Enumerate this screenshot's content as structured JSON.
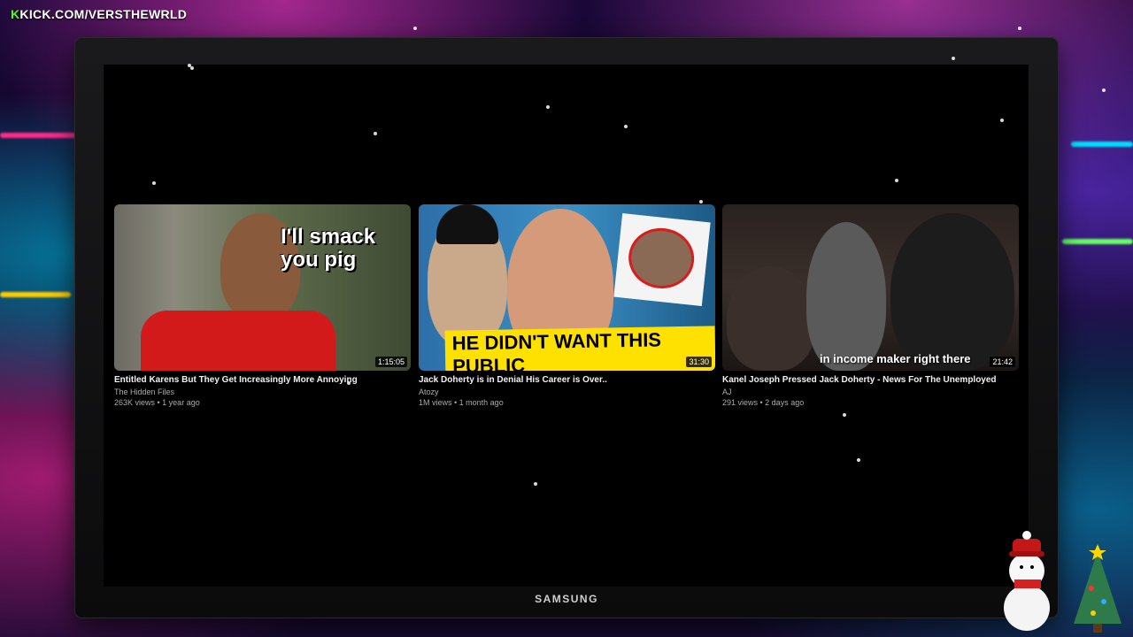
{
  "stream": {
    "channel_url": "KICK.COM/VERSTHEWRLD"
  },
  "monitor": {
    "brand": "SAMSUNG"
  },
  "videos": [
    {
      "thumb_text": "I'll smack\nyou pig",
      "duration": "1:15:05",
      "title": "Entitled Karens But They Get Increasingly More Annoying",
      "channel": "The Hidden Files",
      "meta": "263K views • 1 year ago"
    },
    {
      "thumb_text": "HE DIDN'T WANT THIS PUBLIC",
      "duration": "31:30",
      "title": "Jack Doherty is in Denial His Career is Over..",
      "channel": "Atozy",
      "meta": "1M views • 1 month ago"
    },
    {
      "thumb_text": "in income maker right there",
      "duration": "21:42",
      "title": "Kanel Joseph Pressed Jack Doherty - News For The Unemployed",
      "channel": "AJ",
      "meta": "291 views • 2 days ago"
    }
  ]
}
